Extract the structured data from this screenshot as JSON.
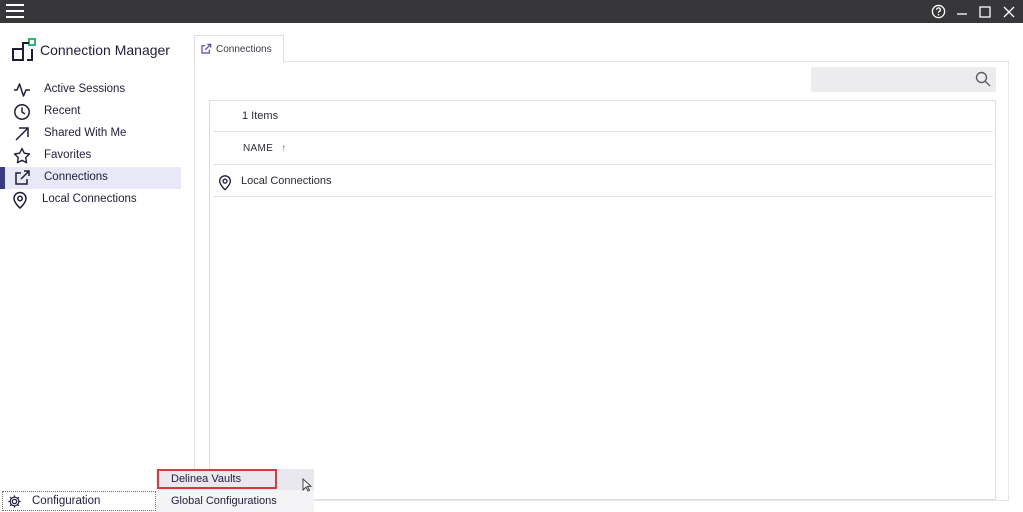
{
  "window": {
    "menu_icon": "hamburger-icon",
    "controls": [
      "help-icon",
      "minimize-icon",
      "maximize-icon",
      "close-icon"
    ]
  },
  "brand": {
    "title": "Connection Manager",
    "accent_green": "#2fb673",
    "accent_navy": "#1f1d3a"
  },
  "sidebar": {
    "items": [
      {
        "label": "Active Sessions",
        "icon": "activity-icon",
        "active": false
      },
      {
        "label": "Recent",
        "icon": "clock-icon",
        "active": false
      },
      {
        "label": "Shared With Me",
        "icon": "arrow-up-right-icon",
        "active": false
      },
      {
        "label": "Favorites",
        "icon": "star-icon",
        "active": false
      },
      {
        "label": "Connections",
        "icon": "external-link-icon",
        "active": true
      },
      {
        "label": "Local Connections",
        "icon": "map-pin-icon",
        "active": false
      }
    ],
    "active_color": "#3d3a84"
  },
  "tabs": [
    {
      "label": "Connections",
      "icon": "external-link-icon"
    }
  ],
  "search": {
    "placeholder": "",
    "value": ""
  },
  "list": {
    "count_label": "1  Items",
    "column_header": "NAME",
    "sort_indicator": "↑",
    "rows": [
      {
        "label": "Local Connections",
        "icon": "map-pin-icon"
      }
    ]
  },
  "footer": {
    "config_label": "Configuration",
    "config_icon": "gear-icon"
  },
  "popup_menu": {
    "items": [
      {
        "label": "Delinea Vaults",
        "highlighted": true
      },
      {
        "label": "Global Configurations",
        "highlighted": false
      }
    ],
    "highlight_color": "#d9393b"
  }
}
